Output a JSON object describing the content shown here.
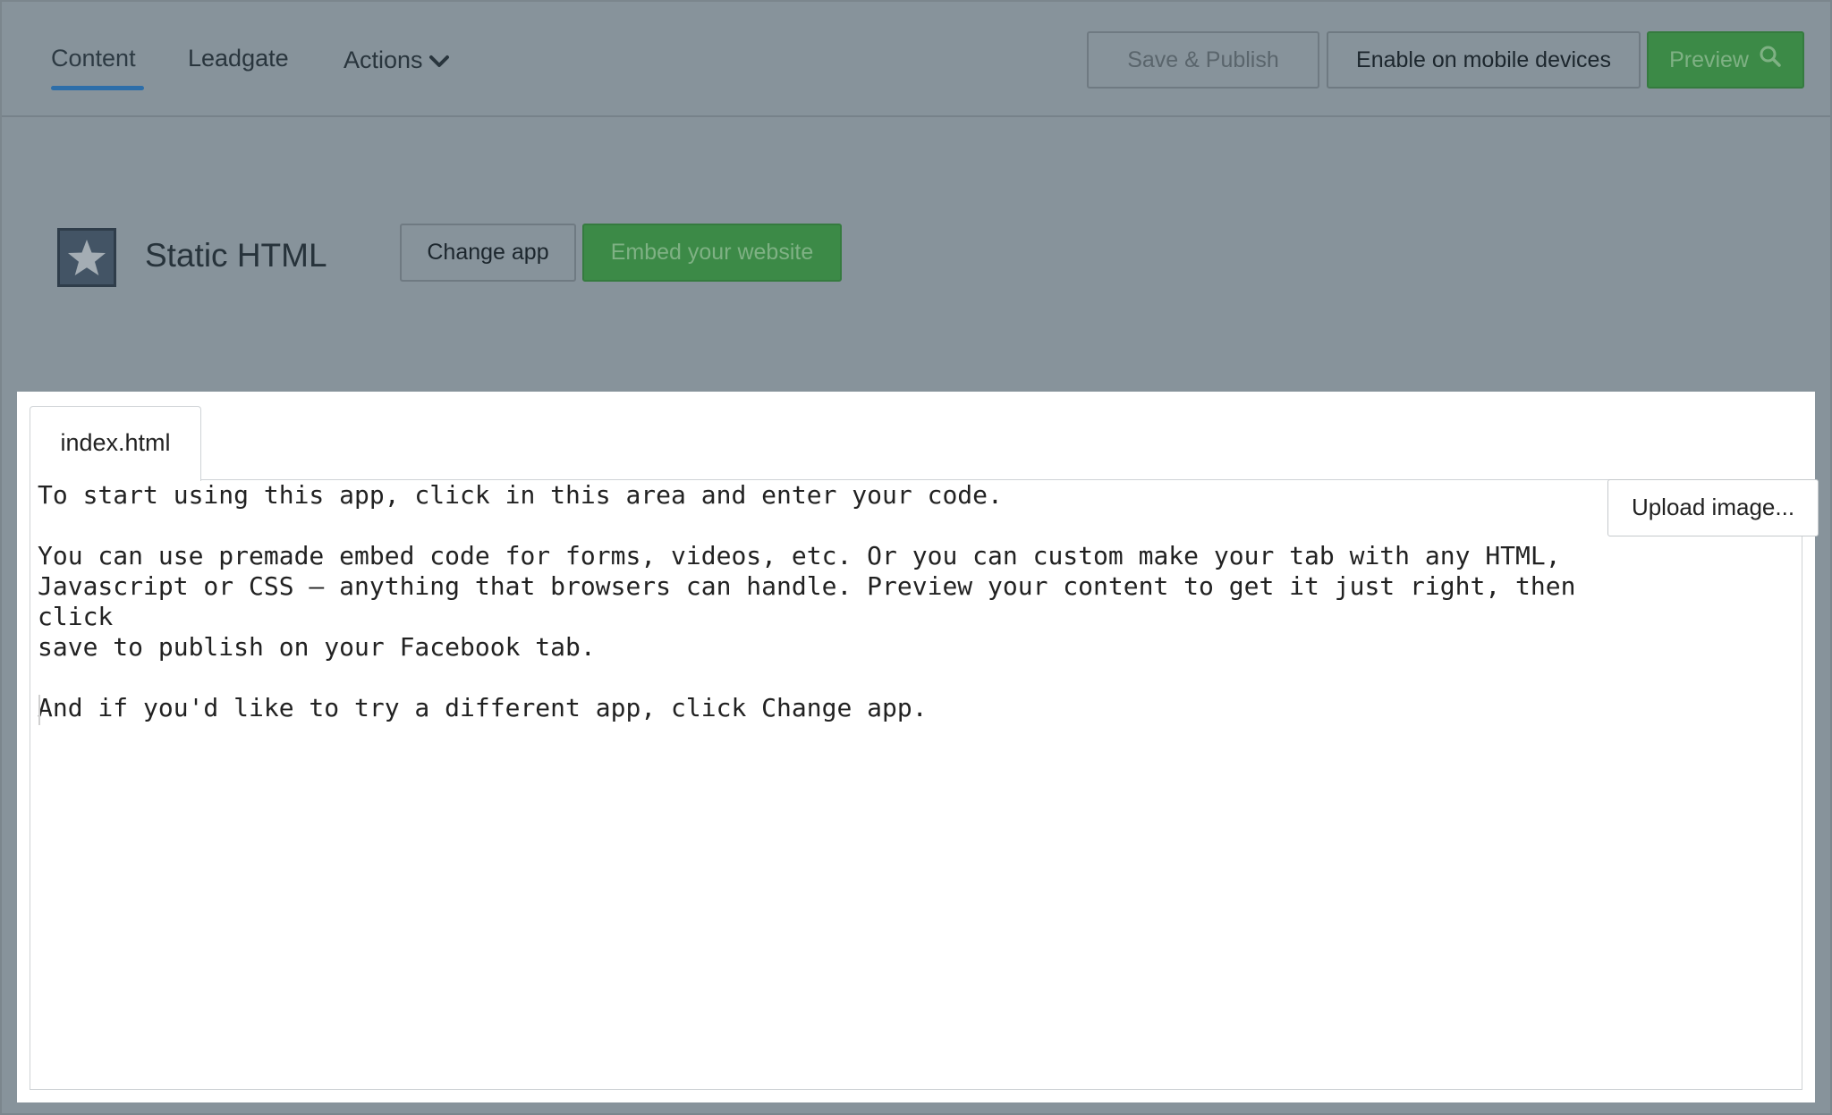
{
  "nav": {
    "tabs": [
      {
        "label": "Content"
      },
      {
        "label": "Leadgate"
      },
      {
        "label": "Actions"
      }
    ],
    "actions_icon": "chevron-down-icon",
    "save_publish_label": "Save & Publish",
    "enable_mobile_label": "Enable on mobile devices",
    "preview_label": "Preview",
    "preview_icon": "search-icon"
  },
  "app": {
    "icon": "star-icon",
    "title": "Static HTML",
    "change_app_label": "Change app",
    "embed_label": "Embed your website"
  },
  "editor": {
    "file_tab": "index.html",
    "upload_label": "Upload image...",
    "content": "To start using this app, click in this area and enter your code.\n\nYou can use premade embed code for forms, videos, etc. Or you can custom make your tab with any HTML,\nJavascript or CSS – anything that browsers can handle. Preview your content to get it just right, then click\nsave to publish on your Facebook tab.\n\nAnd if you'd like to try a different app, click Change app."
  },
  "colors": {
    "overlay": "#87939b",
    "accent_blue": "#2d6ea9",
    "green": "#3c8a47"
  }
}
